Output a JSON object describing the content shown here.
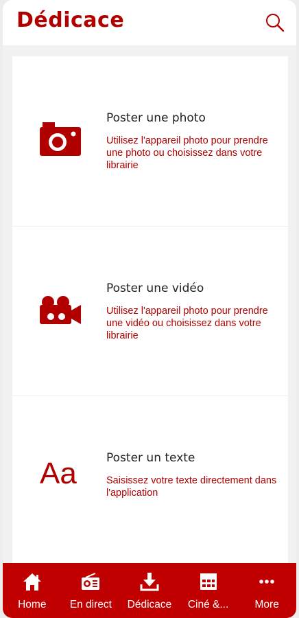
{
  "header": {
    "title": "Dédicace",
    "search_icon": "search-icon"
  },
  "options": [
    {
      "icon": "camera-icon",
      "title": "Poster une photo",
      "description": "Utilisez l'appareil photo pour prendre une photo ou choisissez dans votre librairie"
    },
    {
      "icon": "video-camera-icon",
      "title": "Poster une vidéo",
      "description": "Utilisez l'appareil photo pour prendre une vidéo ou choisissez dans votre librairie"
    },
    {
      "icon": "text-icon",
      "icon_text": "Aa",
      "title": "Poster un texte",
      "description": "Saisissez votre texte directement dans l'application"
    }
  ],
  "tabbar": {
    "items": [
      {
        "label": "Home",
        "icon": "home-icon"
      },
      {
        "label": "En direct",
        "icon": "radio-icon"
      },
      {
        "label": "Dédicace",
        "icon": "download-icon"
      },
      {
        "label": "Ciné &...",
        "icon": "calendar-icon"
      },
      {
        "label": "More",
        "icon": "more-icon"
      }
    ]
  },
  "colors": {
    "accent": "#b00000",
    "tabbar": "#c00000",
    "background": "#f1f1f1"
  }
}
